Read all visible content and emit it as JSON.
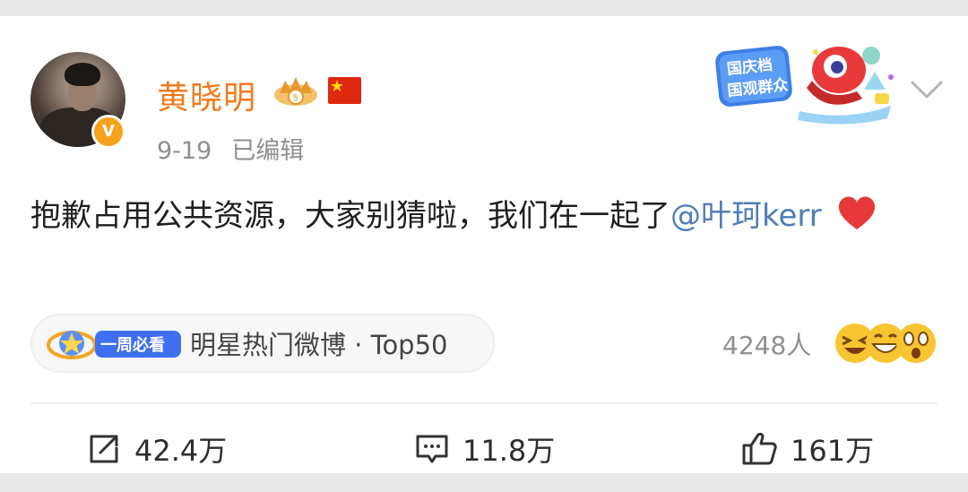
{
  "post": {
    "username": "黄晓明",
    "date": "9-19",
    "edited_label": "已编辑",
    "content_text": "抱歉占用公共资源，大家别猜啦，我们在一起了",
    "mention": "@叶珂kerr",
    "heart_emoji": "❤️"
  },
  "promo_badge": {
    "line1": "国庆档",
    "line2": "国观群众"
  },
  "hot_tag": {
    "badge_label": "一周必看",
    "text": "明星热门微博 · Top50"
  },
  "reactions": {
    "count": "4248人"
  },
  "actions": {
    "repost": "42.4万",
    "comment": "11.8万",
    "like": "161万"
  },
  "colors": {
    "username": "#f37a1c",
    "mention": "#4f7eb8",
    "meta": "#8f8f8f",
    "verified_badge": "#f6a21c"
  },
  "icons": [
    "avatar",
    "verified-v-icon",
    "crown-vip-icon",
    "china-flag-icon",
    "chevron-down-icon",
    "heart-icon",
    "repost-icon",
    "comment-icon",
    "like-icon"
  ]
}
